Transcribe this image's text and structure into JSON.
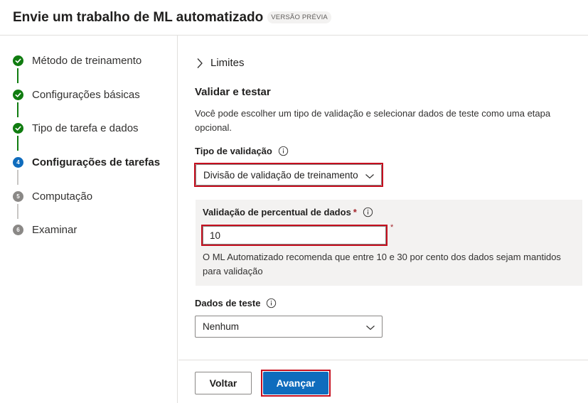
{
  "header": {
    "title": "Envie um trabalho de ML automatizado",
    "badge": "VERSÃO PRÉVIA"
  },
  "steps": [
    {
      "label": "Método de treinamento",
      "status": "done"
    },
    {
      "label": "Configurações básicas",
      "status": "done"
    },
    {
      "label": "Tipo de tarefa e dados",
      "status": "done"
    },
    {
      "label": "Configurações de tarefas",
      "status": "current",
      "number": "4"
    },
    {
      "label": "Computação",
      "status": "todo",
      "number": "5"
    },
    {
      "label": "Examinar",
      "status": "todo",
      "number": "6"
    }
  ],
  "main": {
    "limits_label": "Limites",
    "section_title": "Validar e testar",
    "description": "Você pode escolher um tipo de validação e selecionar dados de teste como uma etapa opcional.",
    "validation_type": {
      "label": "Tipo de validação",
      "value": "Divisão de validação de treinamento"
    },
    "percent_validation": {
      "label": "Validação de percentual de dados",
      "required_mark": "*",
      "value": "10",
      "hint": "O ML Automatizado recomenda que entre 10 e 30 por cento dos dados sejam mantidos para validação"
    },
    "test_data": {
      "label": "Dados de teste",
      "value": "Nenhum"
    }
  },
  "footer": {
    "back_label": "Voltar",
    "next_label": "Avançar"
  },
  "colors": {
    "done": "#107c10",
    "current": "#0f6cbd",
    "todo": "#8a8886",
    "highlight": "#c50f1f"
  }
}
